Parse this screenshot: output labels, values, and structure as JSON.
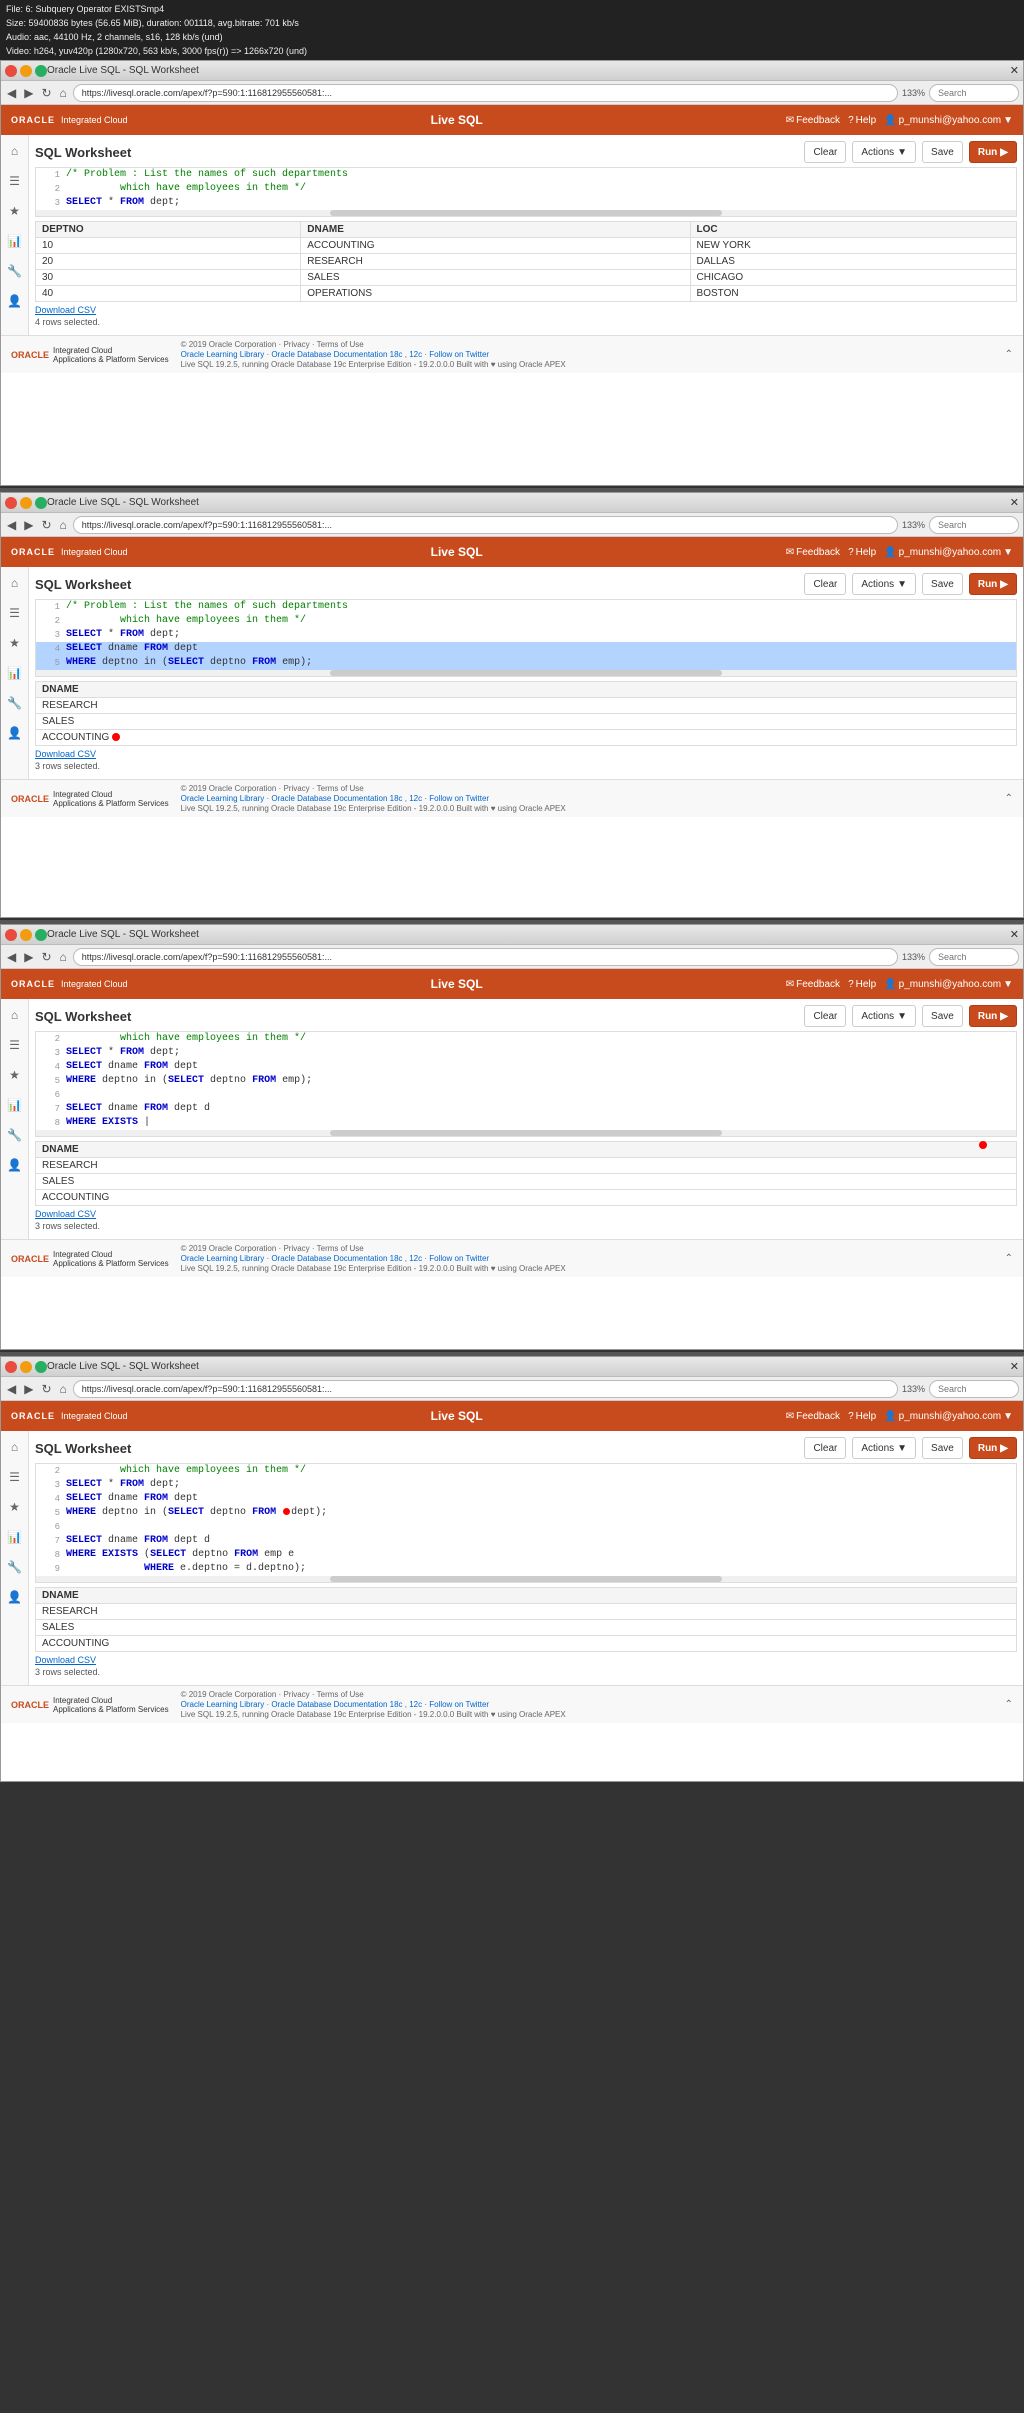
{
  "videoInfo": {
    "file": "File: 6: Subquery Operator EXISTSmp4",
    "size": "Size: 59400836 bytes (56.65 MiB), duration: 001118, avg.bitrate: 701 kb/s",
    "audio": "Audio: aac, 44100 Hz, 2 channels, s16, 128 kb/s (und)",
    "video": "Video: h264, yuv420p (1280x720, 563 kb/s, 3000 fps(r)) => 1266x720 (und)"
  },
  "browserWindow1": {
    "title": "Oracle Live SQL - SQL Worksheet",
    "url": "https://livesql.oracle.com/apex/f?p=590:1:116812955560581:...",
    "zoom": "133%",
    "searchPlaceholder": "Search"
  },
  "browserWindow2": {
    "title": "Oracle Live SQL - SQL Worksheet",
    "url": "https://livesql.oracle.com/apex/f?p=590:1:116812955560581:...",
    "zoom": "133%",
    "searchPlaceholder": "Search"
  },
  "browserWindow3": {
    "title": "Oracle Live SQL - SQL Worksheet",
    "url": "https://livesql.oracle.com/apex/f?p=590:1:116812955560581:...",
    "zoom": "133%",
    "searchPlaceholder": "Search"
  },
  "browserWindow4": {
    "title": "Oracle Live SQL - SQL Worksheet",
    "url": "https://livesql.oracle.com/apex/f?p=590:1:116812955560581:...",
    "zoom": "133%",
    "searchPlaceholder": "Search"
  },
  "oracle": {
    "logoText": "ORACLE",
    "liveSqlText": "Live SQL",
    "feedbackLabel": "Feedback",
    "helpLabel": "Help",
    "userLabel": "p_munshi@yahoo.com",
    "worksheetTitle": "SQL Worksheet",
    "clearLabel": "Clear",
    "actionsLabel": "Actions",
    "saveLabel": "Save",
    "runLabel": "Run"
  },
  "page1": {
    "code": [
      {
        "num": "1",
        "content": "/* Problem : List the names of such departments",
        "highlight": false
      },
      {
        "num": "2",
        "content": "         which have employees in them */",
        "highlight": false
      },
      {
        "num": "3",
        "content": "SELECT * FROM dept;",
        "highlight": false
      }
    ],
    "tableHeaders": [
      "DEPTNO",
      "DNAME",
      "LOC"
    ],
    "tableRows": [
      [
        "10",
        "ACCOUNTING",
        "NEW YORK"
      ],
      [
        "20",
        "RESEARCH",
        "DALLAS"
      ],
      [
        "30",
        "SALES",
        "CHICAGO"
      ],
      [
        "40",
        "OPERATIONS",
        "BOSTON"
      ]
    ],
    "downloadCsv": "Download CSV",
    "rowsSelected": "4 rows selected."
  },
  "page2": {
    "code": [
      {
        "num": "1",
        "content": "/* Problem : List the names of such departments",
        "highlight": false
      },
      {
        "num": "2",
        "content": "         which have employees in them */",
        "highlight": false
      },
      {
        "num": "3",
        "content": "SELECT * FROM dept;",
        "highlight": false
      },
      {
        "num": "4",
        "content": "SELECT dname FROM dept",
        "highlight": true
      },
      {
        "num": "5",
        "content": "WHERE deptno in (SELECT deptno FROM emp);",
        "highlight": true
      }
    ],
    "tableHeader": "DNAME",
    "tableRows": [
      "RESEARCH",
      "SALES",
      "ACCOUNTING"
    ],
    "downloadCsv": "Download CSV",
    "rowsSelected": "3 rows selected."
  },
  "page3": {
    "code": [
      {
        "num": "2",
        "content": "         which have employees in them */",
        "highlight": false
      },
      {
        "num": "3",
        "content": "SELECT * FROM dept;",
        "highlight": false
      },
      {
        "num": "4",
        "content": "SELECT dname FROM dept",
        "highlight": false
      },
      {
        "num": "5",
        "content": "WHERE deptno in (SELECT deptno FROM emp);",
        "highlight": false
      },
      {
        "num": "6",
        "content": "",
        "highlight": false
      },
      {
        "num": "7",
        "content": "SELECT dname FROM dept d",
        "highlight": false
      },
      {
        "num": "8",
        "content": "WHERE EXISTS |",
        "highlight": false
      }
    ],
    "tableHeader": "DNAME",
    "tableRows": [
      "RESEARCH",
      "SALES",
      "ACCOUNTING"
    ],
    "downloadCsv": "Download CSV",
    "rowsSelected": "3 rows selected."
  },
  "page4": {
    "code": [
      {
        "num": "2",
        "content": "         which have employees in them */",
        "highlight": false
      },
      {
        "num": "3",
        "content": "SELECT * FROM dept;",
        "highlight": false
      },
      {
        "num": "4",
        "content": "SELECT dname FROM dept",
        "highlight": false
      },
      {
        "num": "5",
        "content": "WHERE deptno in (SELECT deptno FROM dept);",
        "highlight": false,
        "hasDot": true
      },
      {
        "num": "6",
        "content": "",
        "highlight": false
      },
      {
        "num": "7",
        "content": "SELECT dname FROM dept d",
        "highlight": false
      },
      {
        "num": "8",
        "content": "WHERE EXISTS (SELECT deptno FROM emp e",
        "highlight": false
      },
      {
        "num": "9",
        "content": "             WHERE e.deptno = d.deptno);",
        "highlight": false
      }
    ],
    "tableHeader": "DNAME",
    "tableRows": [
      "RESEARCH",
      "SALES",
      "ACCOUNTING"
    ],
    "downloadCsv": "Download CSV",
    "rowsSelected": "3 rows selected."
  },
  "footer": {
    "copyright": "© 2019 Oracle Corporation · Privacy · Terms of Use",
    "links": [
      "Oracle Learning Library · Oracle Database Documentation 18c , 12c · Follow on Twitter",
      "Live SQL 19.2.5, running Oracle Database 19c Enterprise Edition - 19.2.0.0.0    Built with ♥ using Oracle APEX"
    ]
  }
}
